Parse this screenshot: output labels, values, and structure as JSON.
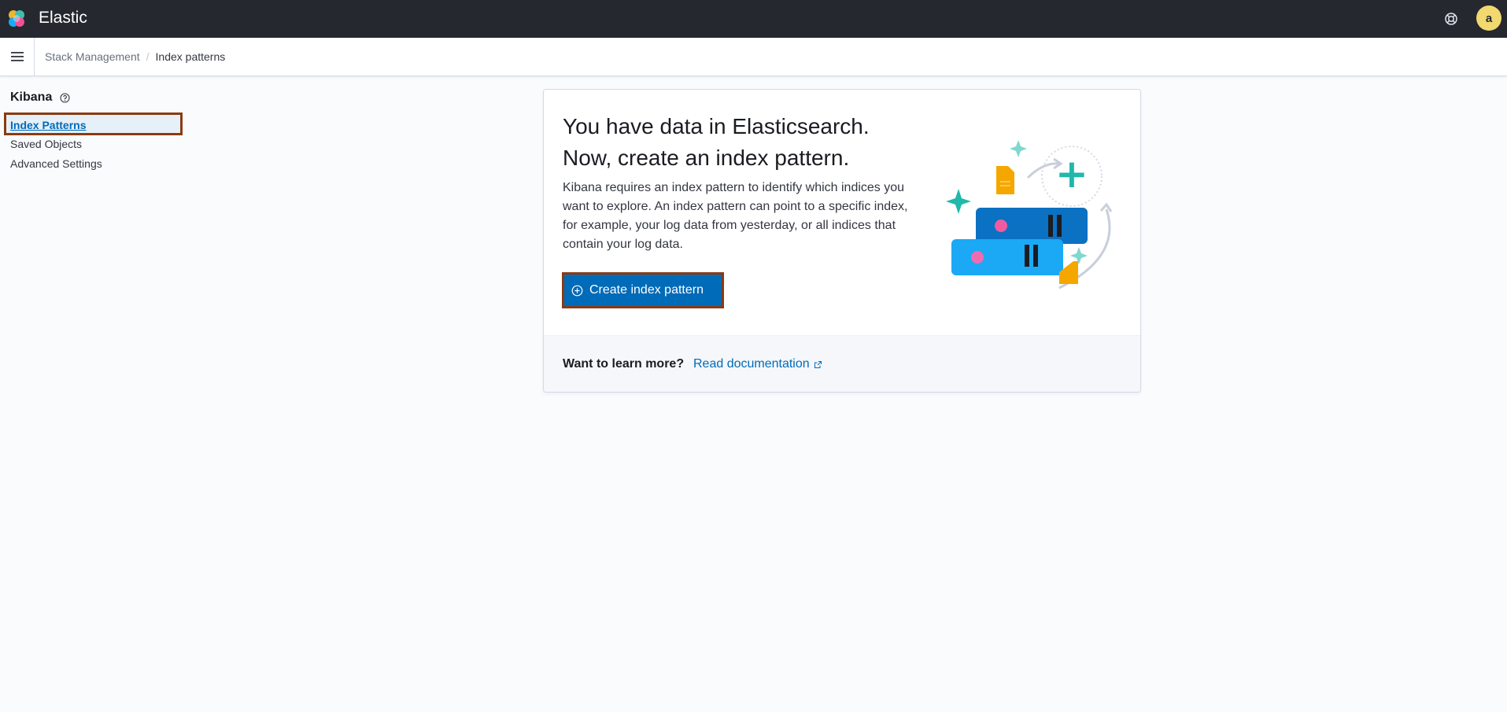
{
  "header": {
    "app_title": "Elastic",
    "help_icon": "help-menu-icon",
    "avatar_initial": "a"
  },
  "breadcrumbs": {
    "items": [
      "Stack Management",
      "Index patterns"
    ],
    "separator": "/"
  },
  "sidebar": {
    "title": "Kibana",
    "items": [
      {
        "label": "Index Patterns",
        "active": true
      },
      {
        "label": "Saved Objects",
        "active": false
      },
      {
        "label": "Advanced Settings",
        "active": false
      }
    ]
  },
  "main": {
    "title_line1": "You have data in Elasticsearch.",
    "title_line2": "Now, create an index pattern.",
    "description": "Kibana requires an index pattern to identify which indices you want to explore. An index pattern can point to a specific index, for example, your log data from yesterday, or all indices that contain your log data.",
    "create_button_label": "Create index pattern",
    "footer_question": "Want to learn more?",
    "footer_link_label": "Read documentation"
  },
  "colors": {
    "topbar": "#25282f",
    "primary": "#006bb8",
    "highlight_border": "#8a3b12",
    "avatar": "#f1d86f"
  }
}
